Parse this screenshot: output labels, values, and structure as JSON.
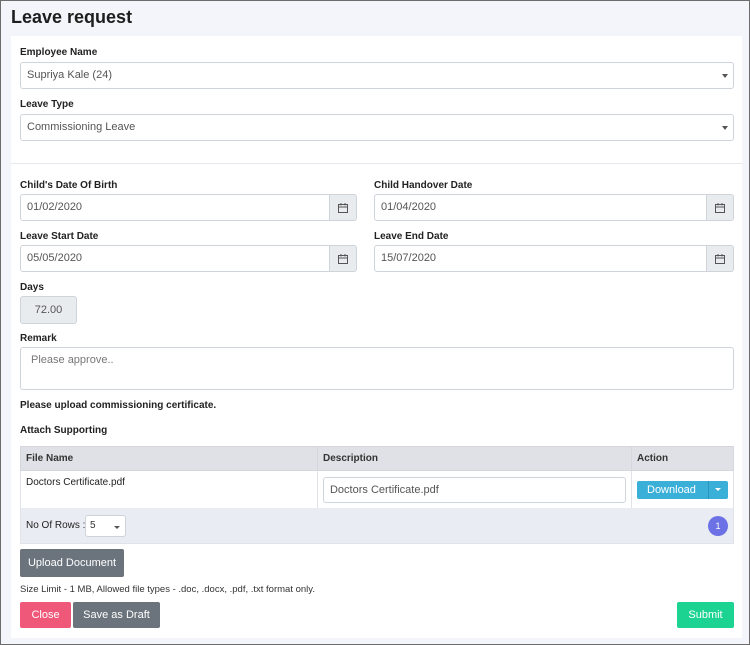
{
  "page": {
    "title": "Leave request"
  },
  "employee": {
    "label": "Employee Name",
    "value": "Supriya Kale (24)"
  },
  "leave_type": {
    "label": "Leave Type",
    "value": "Commissioning Leave"
  },
  "child_dob": {
    "label": "Child's Date Of Birth",
    "value": "01/02/2020"
  },
  "child_handover": {
    "label": "Child Handover Date",
    "value": "01/04/2020"
  },
  "leave_start": {
    "label": "Leave Start Date",
    "value": "05/05/2020"
  },
  "leave_end": {
    "label": "Leave End Date",
    "value": "15/07/2020"
  },
  "days": {
    "label": "Days",
    "value": "72.00"
  },
  "remark": {
    "label": "Remark",
    "placeholder": "Please approve.."
  },
  "upload_note": "Please upload commissioning certificate.",
  "attach": {
    "label": "Attach Supporting",
    "columns": [
      "File Name",
      "Description",
      "Action"
    ],
    "rows": [
      {
        "file_name": "Doctors Certificate.pdf",
        "description": "Doctors Certificate.pdf",
        "action": "Download"
      }
    ],
    "rows_label": "No Of Rows :",
    "rows_value": "5",
    "page": "1"
  },
  "buttons": {
    "upload": "Upload Document",
    "close": "Close",
    "draft": "Save as Draft",
    "submit": "Submit"
  },
  "size_note": "Size Limit - 1 MB, Allowed file types - .doc, .docx, .pdf, .txt format only.",
  "colors": {
    "close": "#f0587a",
    "draft": "#6b737c",
    "submit": "#1dd391",
    "download": "#3ab0d8",
    "page_dot": "#6c72e6"
  }
}
